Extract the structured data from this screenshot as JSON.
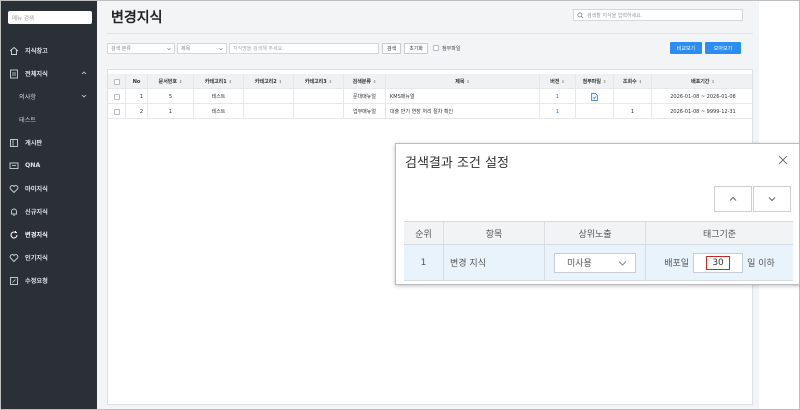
{
  "sidebar": {
    "search_placeholder": "메뉴 검색",
    "items": [
      {
        "label": "지식창고",
        "icon": "home-icon"
      },
      {
        "label": "전체지식",
        "icon": "document-icon"
      },
      {
        "label": "의사항",
        "icon": ""
      },
      {
        "label": "테스트",
        "icon": ""
      },
      {
        "label": "게시판",
        "icon": "board-icon"
      },
      {
        "label": "QNA",
        "icon": "chat-icon"
      },
      {
        "label": "마이지식",
        "icon": "heart-icon"
      },
      {
        "label": "신규지식",
        "icon": "bell-icon"
      },
      {
        "label": "변경지식",
        "icon": "refresh-icon"
      },
      {
        "label": "인기지식",
        "icon": "heart-icon"
      },
      {
        "label": "수정요청",
        "icon": "edit-icon"
      }
    ]
  },
  "header": {
    "title": "변경지식",
    "search_placeholder": "검색할 지식을 입력하세요."
  },
  "filters": {
    "category_select": "검색 분류",
    "field_select": "제목",
    "keyword_placeholder": "지식명을 검색해 주세요.",
    "search_label": "검색",
    "reset_label": "초기화",
    "attachment_label": "첨부파일",
    "compare_label": "비교보기",
    "collect_label": "모아보기"
  },
  "table": {
    "columns": [
      "No",
      "문서번호",
      "카테고리1",
      "카테고리2",
      "카테고리3",
      "검색분류",
      "제목",
      "버전",
      "첨부파일",
      "조회수",
      "배포기간"
    ],
    "rows": [
      {
        "no": "1",
        "doc_no": "5",
        "cat1": "테스트",
        "cat2": "",
        "cat3": "",
        "class": "문대매뉴얼",
        "title": "KMS매뉴얼",
        "version": "1",
        "attachment": true,
        "views": "",
        "period": "2026-01-08 ~ 2026-01-08"
      },
      {
        "no": "2",
        "doc_no": "1",
        "cat1": "테스트",
        "cat2": "",
        "cat3": "",
        "class": "업무매뉴얼",
        "title": "대출 만기 연장 처리 절차 확인",
        "version": "1",
        "attachment": false,
        "views": "1",
        "period": "2026-01-08 ~ 9999-12-31"
      }
    ]
  },
  "modal": {
    "title": "검색결과 조건 설정",
    "columns": [
      "순위",
      "항목",
      "상위노출",
      "태그기준"
    ],
    "row": {
      "rank": "1",
      "item": "변경 지식",
      "exposure": "미사용",
      "tag_prefix": "배포일",
      "tag_value": "30",
      "tag_suffix": "일 이하"
    }
  }
}
